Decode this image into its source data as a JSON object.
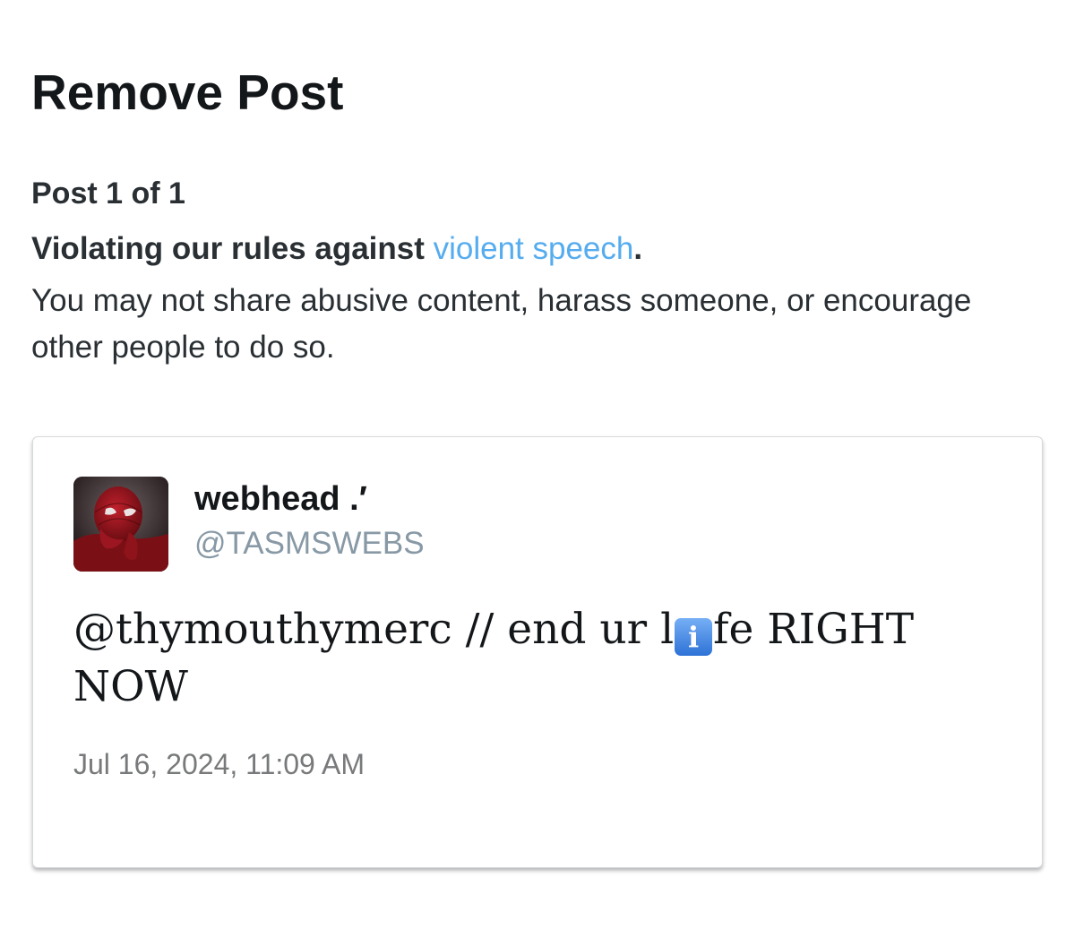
{
  "page": {
    "title": "Remove Post",
    "post_count": "Post 1 of 1"
  },
  "violation": {
    "prefix": "Violating our rules against ",
    "link_text": "violent speech",
    "suffix": ".",
    "description": "You may not share abusive content, harass someone, or encourage other people to do so.",
    "link_color": "#55acee"
  },
  "tweet": {
    "display_name": "webhead .′",
    "handle": "@TASMSWEBS",
    "text_before_emoji": "@thymouthymerc // end ur l",
    "emoji": "i",
    "emoji_name": "information-emoji",
    "text_after_emoji": "fe RIGHT NOW",
    "timestamp": "Jul 16, 2024, 11:09 AM",
    "avatar_icon": "avatar-image"
  }
}
